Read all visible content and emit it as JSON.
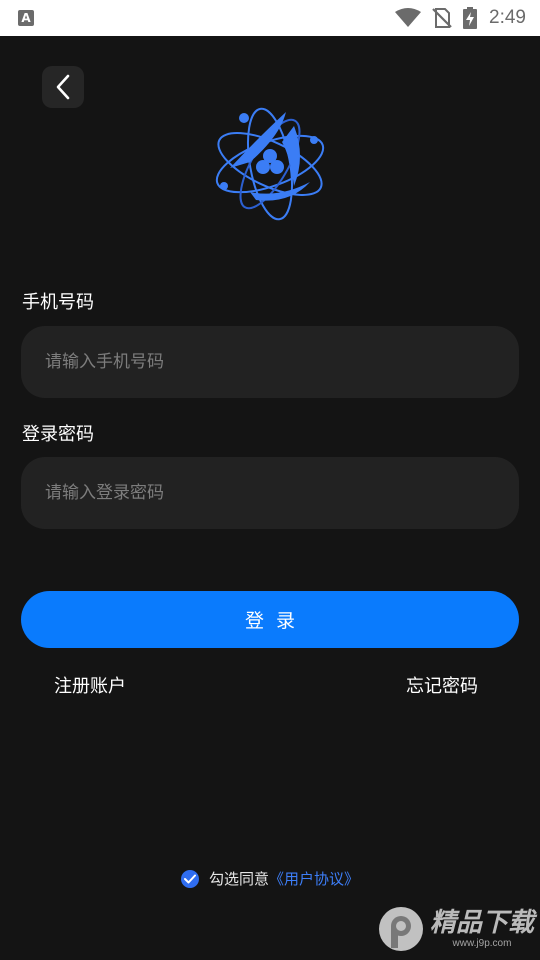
{
  "status_bar": {
    "notification_icon": "A",
    "time": "2:49",
    "icons": [
      "wifi-icon",
      "no-sim-icon",
      "battery-charging-icon"
    ]
  },
  "header": {
    "back_icon": "chevron-left-icon"
  },
  "form": {
    "phone_label": "手机号码",
    "phone_placeholder": "请输入手机号码",
    "phone_value": "",
    "password_label": "登录密码",
    "password_placeholder": "请输入登录密码",
    "password_value": "",
    "login_button": "登录"
  },
  "links": {
    "register": "注册账户",
    "forgot_password": "忘记密码"
  },
  "agreement": {
    "checked": true,
    "text": "勾选同意",
    "link": "《用户协议》"
  },
  "watermark": {
    "title": "精品下载",
    "url": "www.j9p.com"
  },
  "colors": {
    "background": "#141414",
    "input_bg": "#222222",
    "accent": "#0a7bfd",
    "link_blue": "#3d7ef7"
  }
}
